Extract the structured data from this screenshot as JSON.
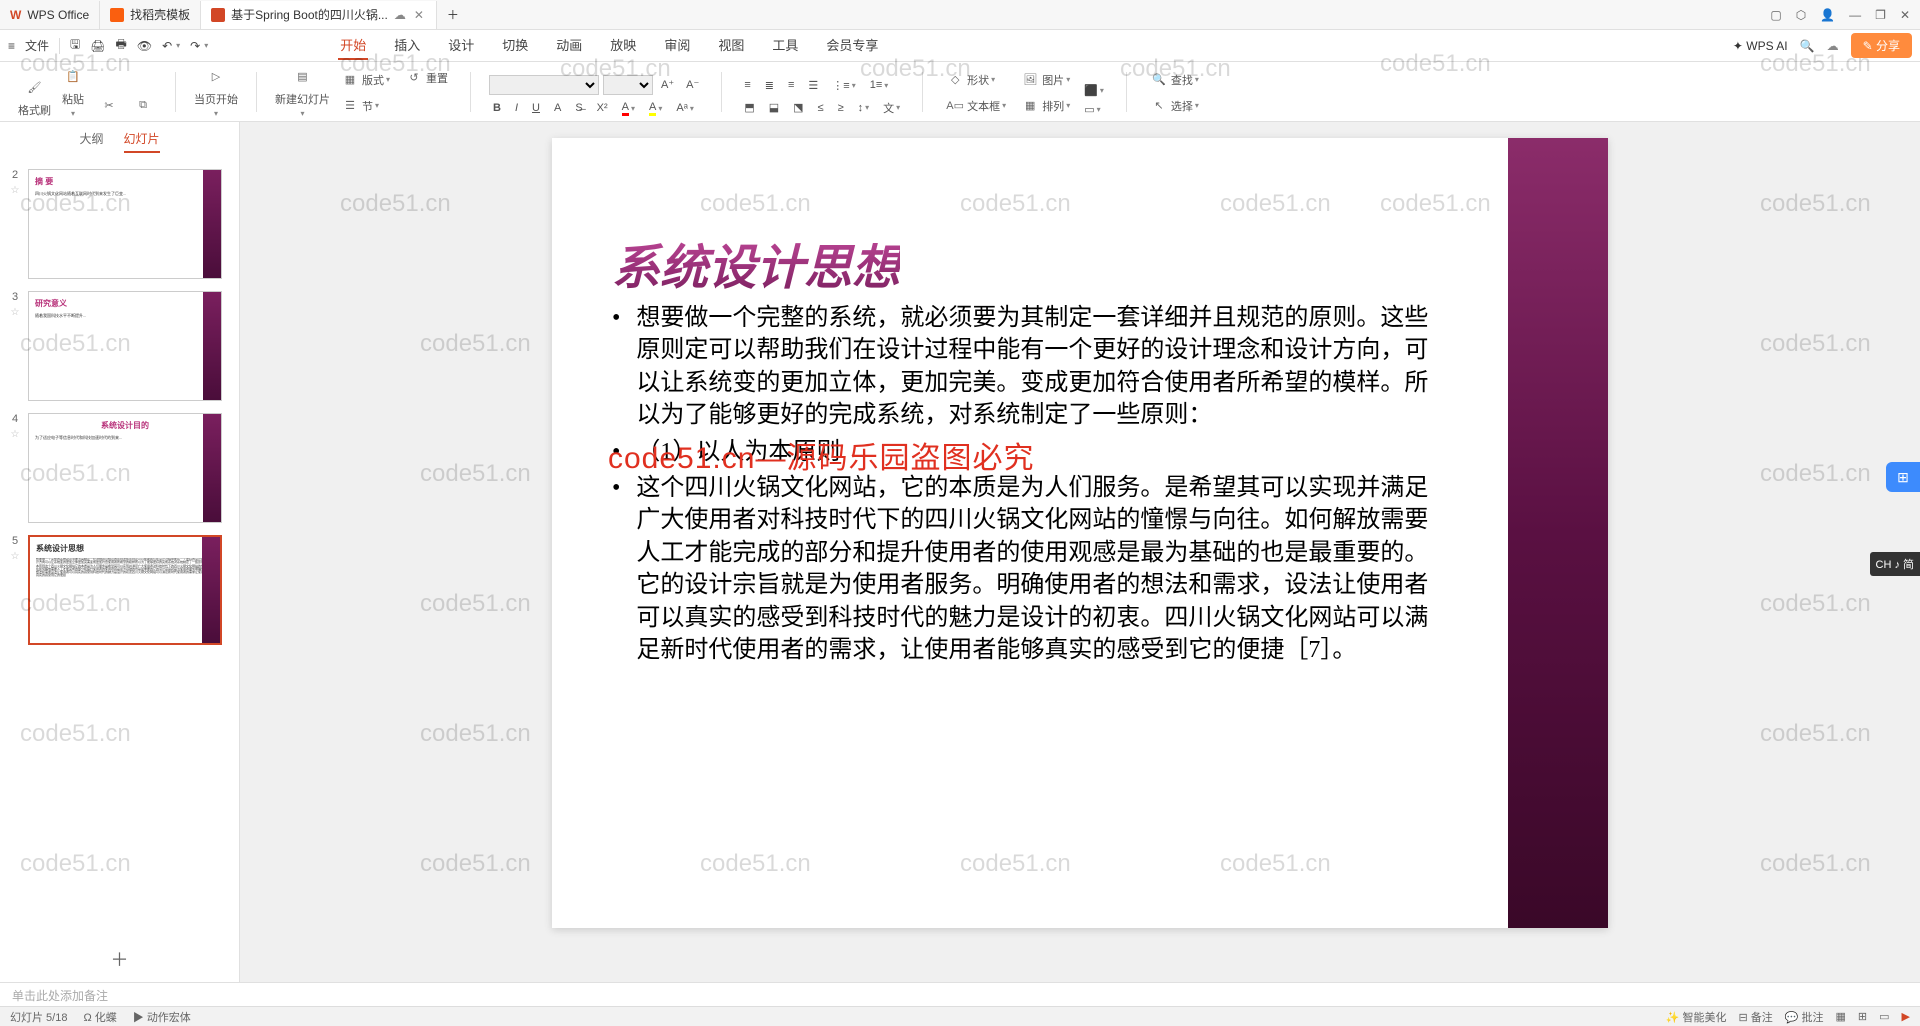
{
  "titlebar": {
    "tabs": [
      {
        "label": "WPS Office",
        "icon": "wps"
      },
      {
        "label": "找稻壳模板",
        "icon": "tpl"
      },
      {
        "label": "基于Spring Boot的四川火锅...",
        "icon": "ppt",
        "active": true
      }
    ],
    "win_icons": [
      "▢",
      "⬡",
      "👤",
      "—",
      "❐",
      "✕"
    ]
  },
  "quickbar": {
    "file": "文件",
    "menu": [
      "开始",
      "插入",
      "设计",
      "切换",
      "动画",
      "放映",
      "审阅",
      "视图",
      "工具",
      "会员专享"
    ],
    "active_menu": "开始",
    "wps_ai": "WPS AI",
    "share": "分享"
  },
  "ribbon": {
    "format_painter": "格式刷",
    "paste": "粘贴",
    "start_page": "当页开始",
    "new_slide": "新建幻灯片",
    "layout": "版式",
    "section": "节",
    "reset": "重置",
    "shape": "形状",
    "picture": "图片",
    "textbox": "文本框",
    "arrange": "排列",
    "find": "查找",
    "select": "选择"
  },
  "sidebar": {
    "tabs": {
      "outline": "大纲",
      "slides": "幻灯片"
    },
    "thumbs": [
      {
        "num": "2",
        "title": "摘 要"
      },
      {
        "num": "3",
        "title": "研究意义"
      },
      {
        "num": "4",
        "title": "系统设计目的"
      },
      {
        "num": "5",
        "title": "系统设计思想",
        "active": true
      }
    ]
  },
  "slide": {
    "title": "系统设计思想",
    "para1": "想要做一个完整的系统，就必须要为其制定一套详细并且规范的原则。这些原则定可以帮助我们在设计过程中能有一个更好的设计理念和设计方向，可以让系统变的更加立体，更加完美。变成更加符合使用者所希望的模样。所以为了能够更好的完成系统，对系统制定了一些原则：",
    "para2": "（1）以人为本原则",
    "para3": "这个四川火锅文化网站，它的本质是为人们服务。是希望其可以实现并满足广大使用者对科技时代下的四川火锅文化网站的憧憬与向往。如何解放需要人工才能完成的部分和提升使用者的使用观感是最为基础的也是最重要的。它的设计宗旨就是为使用者服务。明确使用者的想法和需求，设法让使用者可以真实的感受到科技时代的魅力是设计的初衷。四川火锅文化网站可以满足新时代使用者的需求，让使用者能够真实的感受到它的便捷［7］。",
    "watermark_center": "code51.cn—源码乐园盗图必究"
  },
  "notes": {
    "placeholder": "单击此处添加备注"
  },
  "ime": {
    "label": "CH ♪ 简"
  },
  "status": {
    "left": "幻灯片 5/18",
    "theme": "Ω 化蝶",
    "anim": "动作宏体",
    "right": [
      "智能美化",
      "备注",
      "批注"
    ]
  },
  "watermarks": [
    "code51.cn"
  ]
}
